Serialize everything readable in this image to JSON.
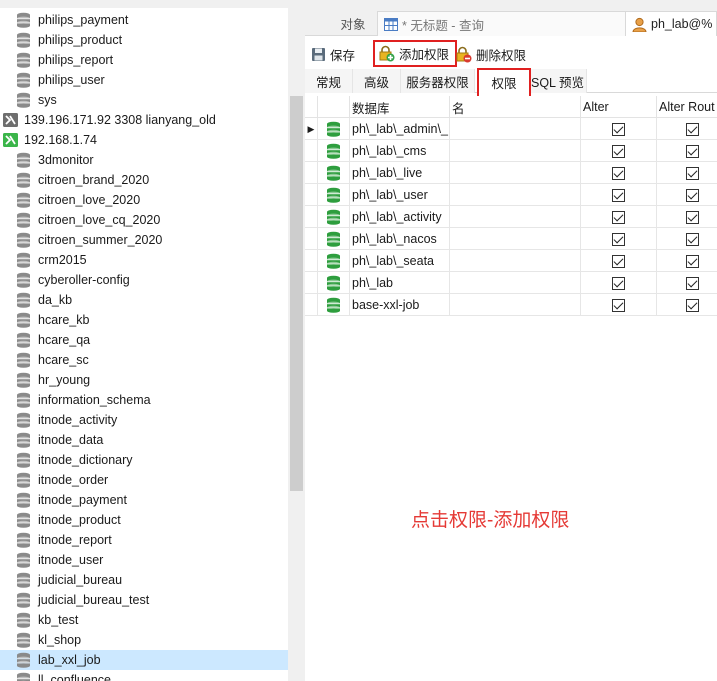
{
  "tree": {
    "items": [
      {
        "label": "philips_payment",
        "kind": "db"
      },
      {
        "label": "philips_product",
        "kind": "db"
      },
      {
        "label": "philips_report",
        "kind": "db"
      },
      {
        "label": "philips_user",
        "kind": "db"
      },
      {
        "label": "sys",
        "kind": "db"
      },
      {
        "label": "139.196.171.92 3308 lianyang_old",
        "kind": "conn-off"
      },
      {
        "label": "192.168.1.74",
        "kind": "conn-on"
      },
      {
        "label": "3dmonitor",
        "kind": "db"
      },
      {
        "label": "citroen_brand_2020",
        "kind": "db"
      },
      {
        "label": "citroen_love_2020",
        "kind": "db"
      },
      {
        "label": "citroen_love_cq_2020",
        "kind": "db"
      },
      {
        "label": "citroen_summer_2020",
        "kind": "db"
      },
      {
        "label": "crm2015",
        "kind": "db"
      },
      {
        "label": "cyberoller-config",
        "kind": "db"
      },
      {
        "label": "da_kb",
        "kind": "db"
      },
      {
        "label": "hcare_kb",
        "kind": "db"
      },
      {
        "label": "hcare_qa",
        "kind": "db"
      },
      {
        "label": "hcare_sc",
        "kind": "db"
      },
      {
        "label": "hr_young",
        "kind": "db"
      },
      {
        "label": "information_schema",
        "kind": "db"
      },
      {
        "label": "itnode_activity",
        "kind": "db"
      },
      {
        "label": "itnode_data",
        "kind": "db"
      },
      {
        "label": "itnode_dictionary",
        "kind": "db"
      },
      {
        "label": "itnode_order",
        "kind": "db"
      },
      {
        "label": "itnode_payment",
        "kind": "db"
      },
      {
        "label": "itnode_product",
        "kind": "db"
      },
      {
        "label": "itnode_report",
        "kind": "db"
      },
      {
        "label": "itnode_user",
        "kind": "db"
      },
      {
        "label": "judicial_bureau",
        "kind": "db"
      },
      {
        "label": "judicial_bureau_test",
        "kind": "db"
      },
      {
        "label": "kb_test",
        "kind": "db"
      },
      {
        "label": "kl_shop",
        "kind": "db"
      },
      {
        "label": "lab_xxl_job",
        "kind": "db",
        "selected": true
      },
      {
        "label": "ll_confluence",
        "kind": "db"
      }
    ]
  },
  "tabs": {
    "objects": "对象",
    "query": "* 无标题 - 查询",
    "user": "ph_lab@%"
  },
  "toolbar": {
    "save": "保存",
    "add_privilege": "添加权限",
    "delete_privilege": "删除权限"
  },
  "subtabs": {
    "general": "常规",
    "advanced": "高级",
    "server_privileges": "服务器权限",
    "privileges": "权限",
    "sql_preview": "SQL 预览"
  },
  "grid": {
    "headers": {
      "database": "数据库",
      "name": "名",
      "alter": "Alter",
      "alter_routine": "Alter Rout"
    },
    "rows": [
      {
        "database": "ph\\_lab\\_admin\\_",
        "name": "",
        "alter": true,
        "alter_routine": true,
        "current": true
      },
      {
        "database": "ph\\_lab\\_cms",
        "name": "",
        "alter": true,
        "alter_routine": true
      },
      {
        "database": "ph\\_lab\\_live",
        "name": "",
        "alter": true,
        "alter_routine": true
      },
      {
        "database": "ph\\_lab\\_user",
        "name": "",
        "alter": true,
        "alter_routine": true
      },
      {
        "database": "ph\\_lab\\_activity",
        "name": "",
        "alter": true,
        "alter_routine": true
      },
      {
        "database": "ph\\_lab\\_nacos",
        "name": "",
        "alter": true,
        "alter_routine": true
      },
      {
        "database": "ph\\_lab\\_seata",
        "name": "",
        "alter": true,
        "alter_routine": true
      },
      {
        "database": "ph\\_lab",
        "name": "",
        "alter": true,
        "alter_routine": true
      },
      {
        "database": "base-xxl-job",
        "name": "",
        "alter": true,
        "alter_routine": true
      }
    ]
  },
  "annotation": "点击权限-添加权限",
  "colors": {
    "highlight_red": "#e02020",
    "annotation_red": "#e53935",
    "db_icon_green": "#2e9e3e",
    "db_icon_gray": "#8a8a8a",
    "selection_blue": "#cce8ff"
  }
}
